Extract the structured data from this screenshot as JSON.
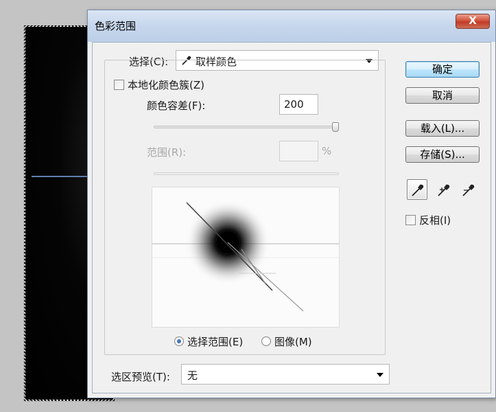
{
  "dialog": {
    "title": "色彩范围",
    "close_label": "X"
  },
  "select": {
    "label": "选择(C):",
    "value": "取样颜色",
    "icon": "eyedropper-icon"
  },
  "localized_clusters": {
    "label": "本地化颜色簇(Z)",
    "checked": false
  },
  "fuzziness": {
    "label": "颜色容差(F):",
    "value": "200",
    "slider_fraction": 1.0
  },
  "range": {
    "label": "范围(R):",
    "value": "",
    "unit": "%",
    "disabled": true
  },
  "preview_mode": {
    "options": [
      {
        "label": "选择范围(E)",
        "checked": true
      },
      {
        "label": "图像(M)",
        "checked": false
      }
    ]
  },
  "selection_preview": {
    "label": "选区预览(T):",
    "value": "无"
  },
  "buttons": {
    "ok": "确定",
    "cancel": "取消",
    "load": "载入(L)...",
    "save": "存储(S)..."
  },
  "eyedroppers": [
    {
      "icon": "eyedropper-icon",
      "active": true
    },
    {
      "icon": "eyedropper-plus-icon",
      "active": false
    },
    {
      "icon": "eyedropper-minus-icon",
      "active": false
    }
  ],
  "invert": {
    "label": "反相(I)",
    "checked": false
  }
}
